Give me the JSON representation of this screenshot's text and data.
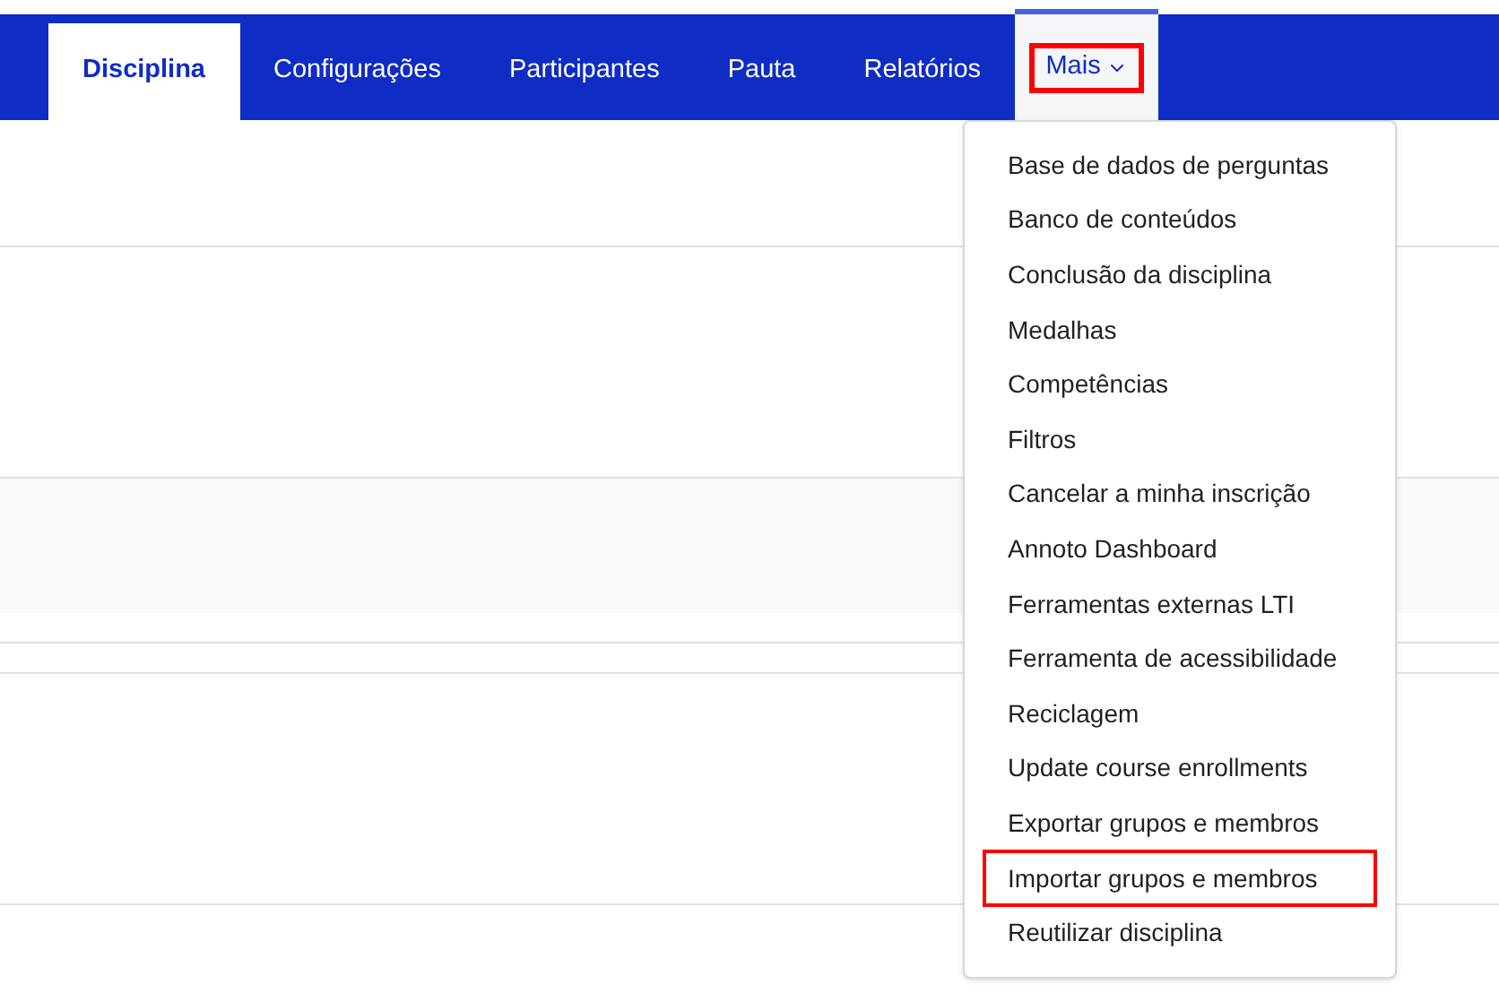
{
  "tabs": [
    {
      "label": "Disciplina",
      "selected": true,
      "highlighted": false,
      "kind": "tab"
    },
    {
      "label": "Configurações",
      "selected": false,
      "highlighted": false,
      "kind": "tab"
    },
    {
      "label": "Participantes",
      "selected": false,
      "highlighted": false,
      "kind": "tab"
    },
    {
      "label": "Pauta",
      "selected": false,
      "highlighted": false,
      "kind": "tab"
    },
    {
      "label": "Relatórios",
      "selected": false,
      "highlighted": false,
      "kind": "tab"
    },
    {
      "label": "Mais",
      "selected": false,
      "highlighted": true,
      "kind": "dropdown",
      "expanded": true
    }
  ],
  "menu": {
    "items": [
      {
        "label": "Base de dados de perguntas",
        "highlighted": false
      },
      {
        "label": "Banco de conteúdos",
        "highlighted": false
      },
      {
        "label": "Conclusão da disciplina",
        "highlighted": false
      },
      {
        "label": "Medalhas",
        "highlighted": false
      },
      {
        "label": "Competências",
        "highlighted": false
      },
      {
        "label": "Filtros",
        "highlighted": false
      },
      {
        "label": "Cancelar a minha inscrição",
        "highlighted": false
      },
      {
        "label": "Annoto Dashboard",
        "highlighted": false
      },
      {
        "label": "Ferramentas externas LTI",
        "highlighted": false
      },
      {
        "label": "Ferramenta de acessibilidade",
        "highlighted": false
      },
      {
        "label": "Reciclagem",
        "highlighted": false
      },
      {
        "label": "Update course enrollments",
        "highlighted": false
      },
      {
        "label": "Exportar grupos e membros",
        "highlighted": false
      },
      {
        "label": "Importar grupos e membros",
        "highlighted": true
      },
      {
        "label": "Reutilizar disciplina",
        "highlighted": false
      }
    ]
  }
}
